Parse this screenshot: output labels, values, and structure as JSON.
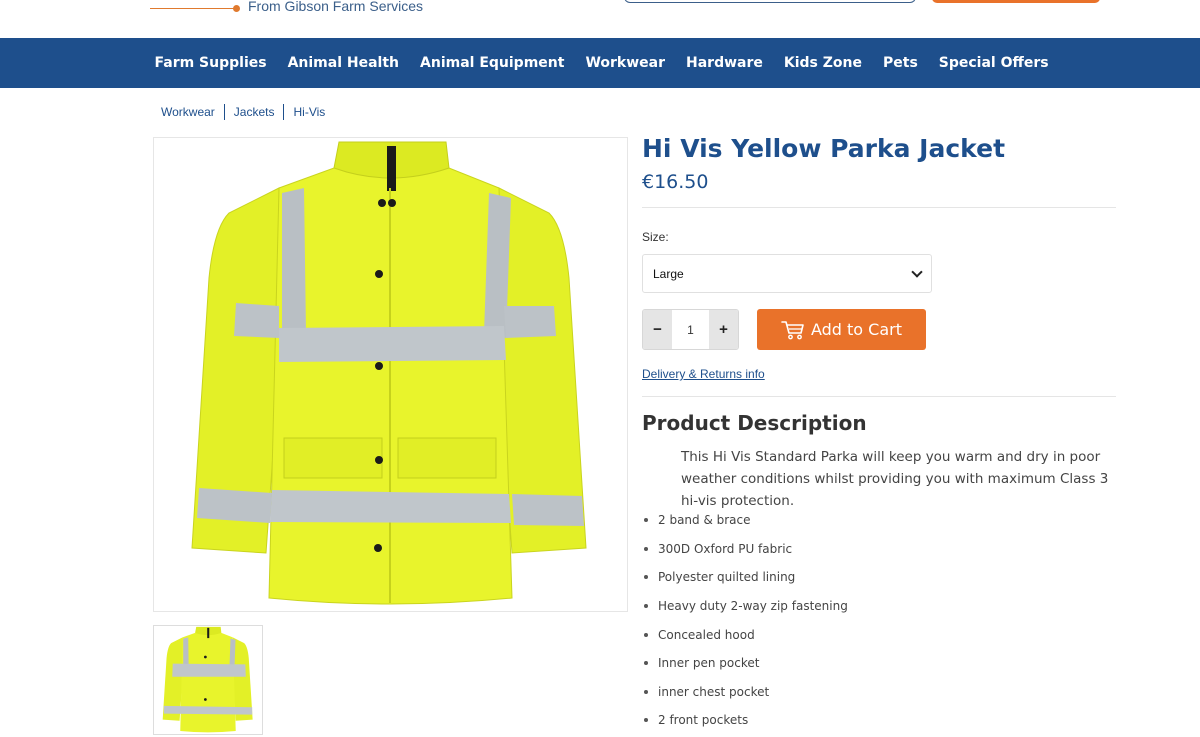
{
  "header": {
    "tagline": "From Gibson Farm Services"
  },
  "nav": {
    "items": [
      "Farm Supplies",
      "Animal Health",
      "Animal Equipment",
      "Workwear",
      "Hardware",
      "Kids Zone",
      "Pets",
      "Special Offers"
    ]
  },
  "breadcrumb": [
    "Workwear",
    "Jackets",
    "Hi-Vis"
  ],
  "product": {
    "title": "Hi Vis Yellow Parka Jacket",
    "price": "€16.50",
    "size_label": "Size:",
    "size_selected": "Large",
    "quantity": "1",
    "qty_minus": "−",
    "qty_plus": "+",
    "add_to_cart": "Add to Cart",
    "delivery_link": "Delivery & Returns info",
    "description_title": "Product Description",
    "description": "This Hi Vis Standard Parka will keep you warm and dry in poor weather conditions whilst providing you with maximum Class 3 hi-vis protection.",
    "features": [
      "2 band & brace",
      "300D Oxford PU fabric",
      "Polyester quilted lining",
      "Heavy duty 2-way zip fastening",
      "Concealed hood",
      "Inner pen pocket",
      "inner chest pocket",
      "2 front pockets"
    ]
  },
  "colors": {
    "nav_bg": "#1e4f8c",
    "accent": "#e9722a",
    "jacket_yellow": "#e6f22a"
  }
}
